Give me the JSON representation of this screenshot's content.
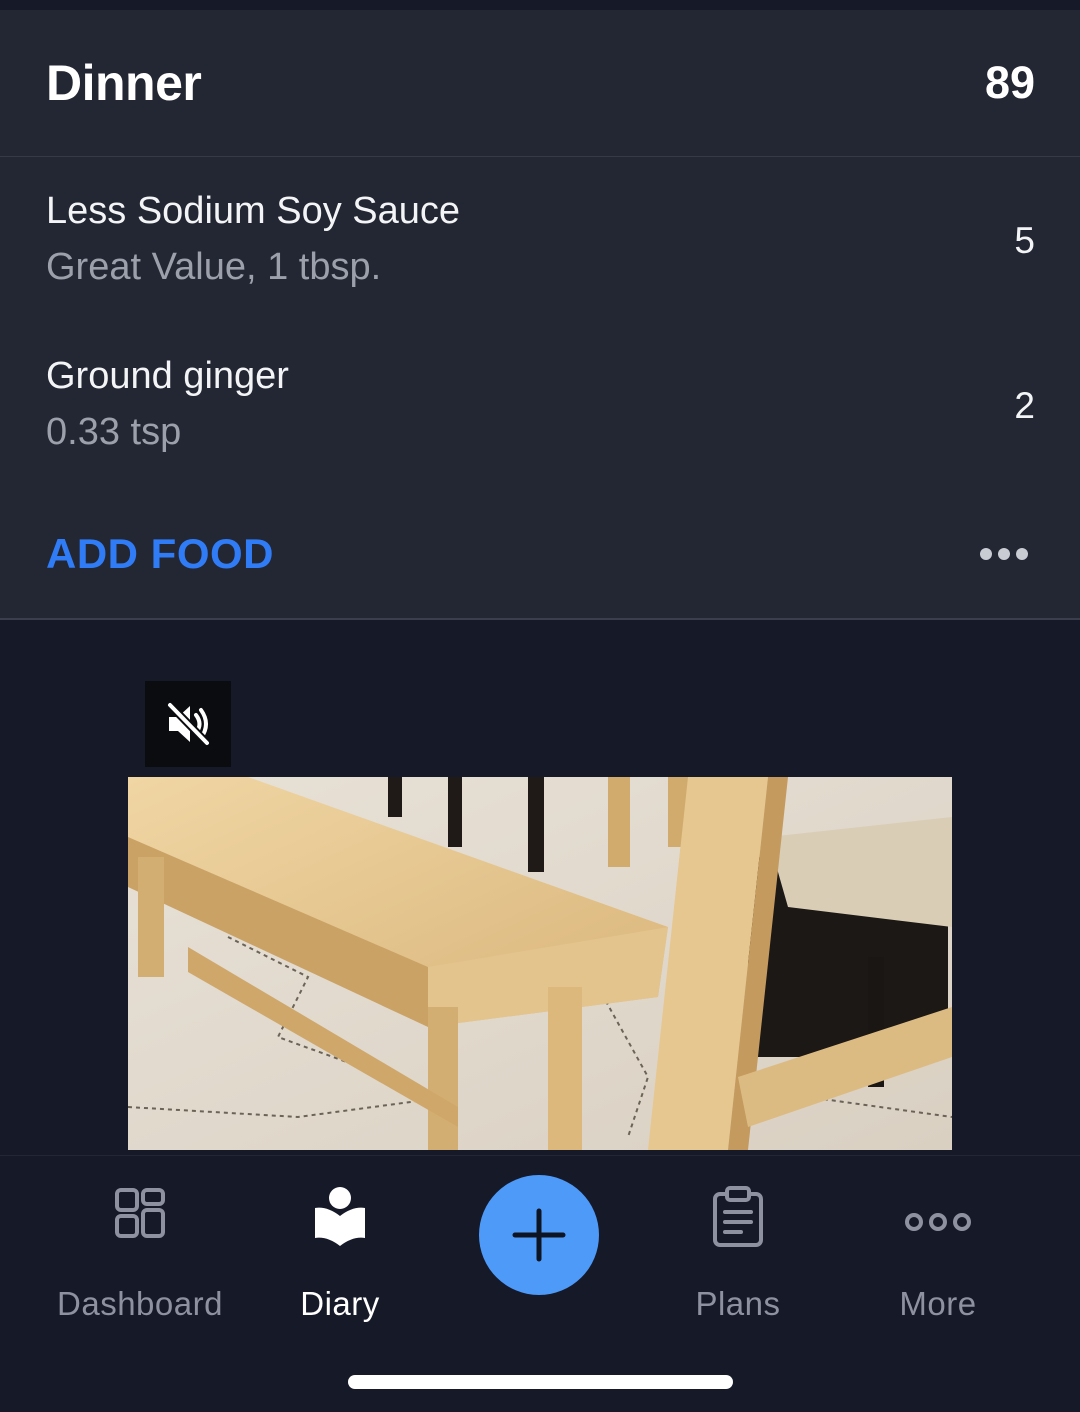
{
  "meal": {
    "title": "Dinner",
    "total_calories": "89",
    "items": [
      {
        "name": "Less Sodium Soy Sauce",
        "detail": "Great Value, 1 tbsp.",
        "calories": "5"
      },
      {
        "name": "Ground ginger",
        "detail": "0.33 tsp",
        "calories": "2"
      }
    ],
    "add_food_label": "ADD FOOD"
  },
  "ad": {
    "muted": true
  },
  "tabbar": {
    "tabs": [
      {
        "label": "Dashboard",
        "icon": "dashboard-grid-icon",
        "active": false
      },
      {
        "label": "Diary",
        "icon": "diary-book-icon",
        "active": true
      },
      {
        "label": "Plans",
        "icon": "clipboard-icon",
        "active": false
      },
      {
        "label": "More",
        "icon": "more-dots-icon",
        "active": false
      }
    ],
    "add_button_icon": "plus-icon"
  },
  "colors": {
    "accent_blue": "#2f7cf6",
    "fab_blue": "#4d9af9",
    "card_bg": "#232633",
    "page_bg": "#161928"
  }
}
